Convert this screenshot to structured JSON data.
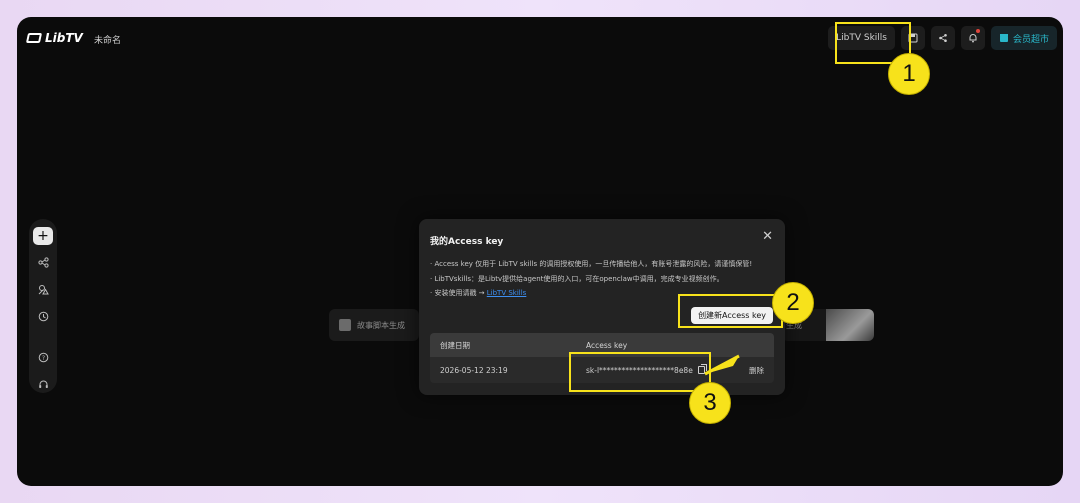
{
  "header": {
    "brand": "LibTV",
    "doc_title": "未命名",
    "skills_label": "LibTV Skills",
    "vip_label": "会员超市"
  },
  "sidebar": {
    "items": [
      {
        "icon": "add-icon"
      },
      {
        "icon": "nodes-icon"
      },
      {
        "icon": "asset-icon"
      },
      {
        "icon": "history-icon"
      },
      {
        "icon": "help-icon"
      },
      {
        "icon": "headset-icon"
      }
    ]
  },
  "canvas": {
    "chip_left_label": "故事脚本生成",
    "chip_right_label": "生成"
  },
  "modal": {
    "title": "我的Access key",
    "notes": [
      "· Access key 仅用于 LibTV skills 的调用授权使用，一旦传播给他人，有账号泄露的风险，请谨慎保管!",
      "· LibTVskills：是Libtv提供给agent使用的入口，可在openclaw中调用，完成专业视频创作。",
      "· 安装使用请戳 → "
    ],
    "link_label": "LibTV Skills",
    "create_button": "创建新Access key",
    "table": {
      "headers": [
        "创建日期",
        "Access key"
      ],
      "rows": [
        {
          "date": "2026-05-12 23:19",
          "key": "sk-l********************8e8e",
          "action": "删除"
        }
      ]
    }
  },
  "annotations": {
    "labels": [
      "1",
      "2",
      "3"
    ],
    "highlight_color": "#f7e21b"
  }
}
